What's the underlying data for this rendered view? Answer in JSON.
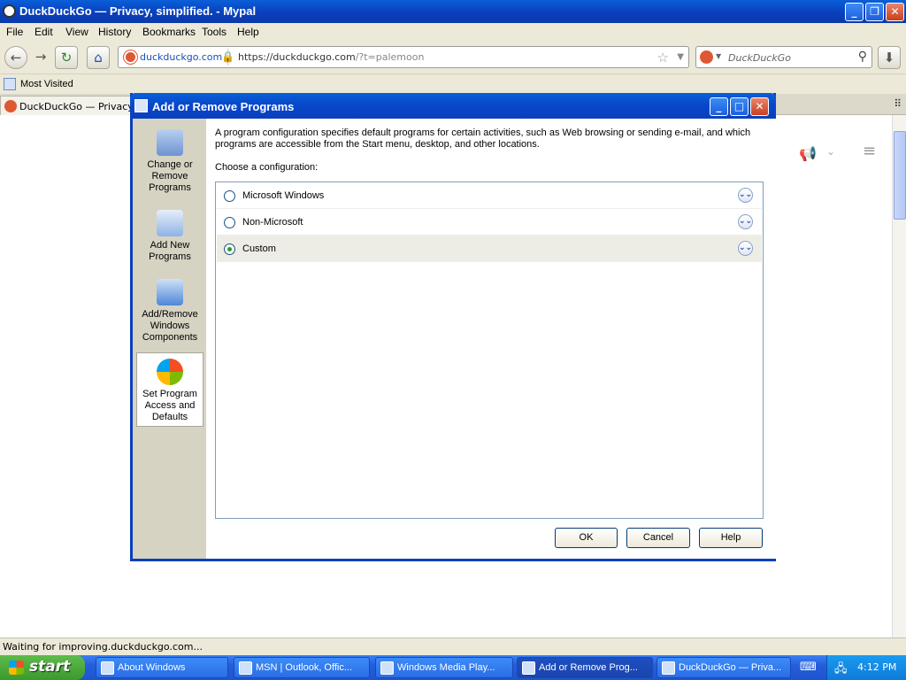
{
  "browser": {
    "title": "DuckDuckGo — Privacy, simplified. - Mypal",
    "menu": [
      "File",
      "Edit",
      "View",
      "History",
      "Bookmarks",
      "Tools",
      "Help"
    ],
    "site_identity": "duckduckgo.com",
    "url_main": "https://duckduckgo.com",
    "url_query": "/?t=palemoon",
    "search_placeholder": "DuckDuckGo",
    "bookmark": "Most Visited",
    "tab_title": "DuckDuckGo — Privacy, simplified.",
    "status": "Waiting for improving.duckduckgo.com..."
  },
  "dialog": {
    "title": "Add or Remove Programs",
    "sidebar": [
      {
        "label": "Change or Remove Programs"
      },
      {
        "label": "Add New Programs"
      },
      {
        "label": "Add/Remove Windows Components"
      },
      {
        "label": "Set Program Access and Defaults"
      }
    ],
    "intro": "A program configuration specifies default programs for certain activities, such as Web browsing or sending e-mail, and which programs are accessible from the Start menu, desktop, and other locations.",
    "choose_label": "Choose a configuration:",
    "configurations": [
      {
        "label": "Microsoft Windows",
        "selected": false
      },
      {
        "label": "Non-Microsoft",
        "selected": false
      },
      {
        "label": "Custom",
        "selected": true
      }
    ],
    "buttons": {
      "ok": "OK",
      "cancel": "Cancel",
      "help": "Help"
    }
  },
  "taskbar": {
    "start": "start",
    "tasks": [
      "About Windows",
      "MSN | Outlook, Offic...",
      "Windows Media Play...",
      "Add or Remove Prog...",
      "DuckDuckGo — Priva..."
    ],
    "clock": "4:12 PM"
  }
}
